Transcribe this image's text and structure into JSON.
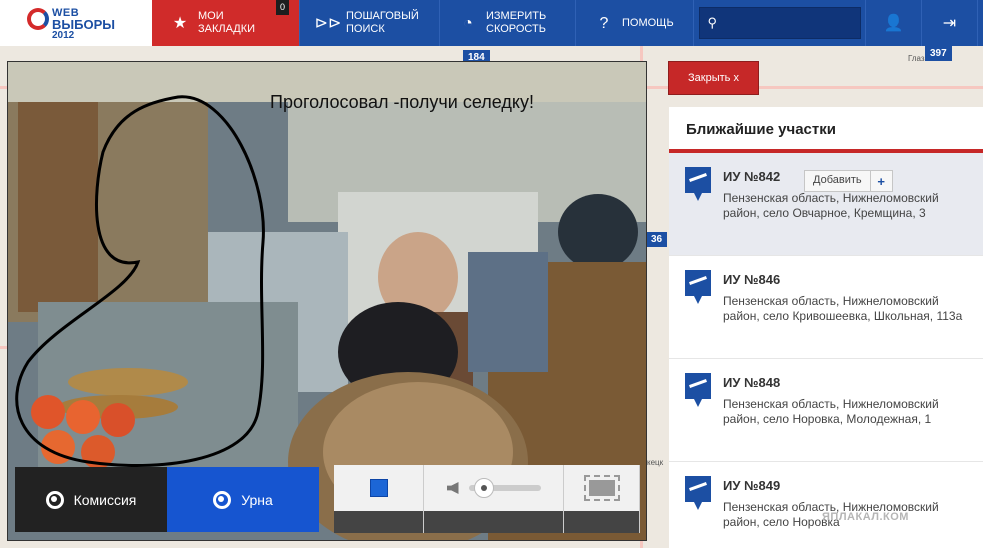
{
  "app": {
    "logo_line1": "WEB",
    "logo_line2": "ВЫБОРЫ",
    "logo_line3": "2012"
  },
  "nav": {
    "bookmarks_label": "МОИ ЗАКЛАДКИ",
    "bookmarks_count": "0",
    "stepwise_search_label": "ПОШАГОВЫЙ ПОИСК",
    "measure_speed_label": "ИЗМЕРИТЬ СКОРОСТЬ",
    "help_label": "ПОМОЩЬ",
    "search_value": ""
  },
  "map": {
    "markers": [
      "184",
      "397",
      "36"
    ],
    "cities": [
      "Глаз",
      "кецк"
    ]
  },
  "video": {
    "caption": "Проголосовал -получи селедку!",
    "commission_label": "Комиссия",
    "urn_label": "Урна",
    "volume_level": 0.1
  },
  "close_label": "Закрыть x",
  "panel": {
    "title": "Ближайшие участки",
    "add_label": "Добавить",
    "stations": [
      {
        "name": "ИУ №842",
        "address": "Пензенская область, Нижнеломовский район, село Овчарное, Кремщина, 3"
      },
      {
        "name": "ИУ №846",
        "address": "Пензенская область, Нижнеломовский район, село Кривошеевка, Школьная, 113а"
      },
      {
        "name": "ИУ №848",
        "address": "Пензенская область, Нижнеломовский район, село Норовка, Молодежная, 1"
      },
      {
        "name": "ИУ №849",
        "address": "Пензенская область, Нижнеломовский район, село Норовка"
      }
    ]
  },
  "watermark": "ЯПЛАКАЛ.КОМ"
}
